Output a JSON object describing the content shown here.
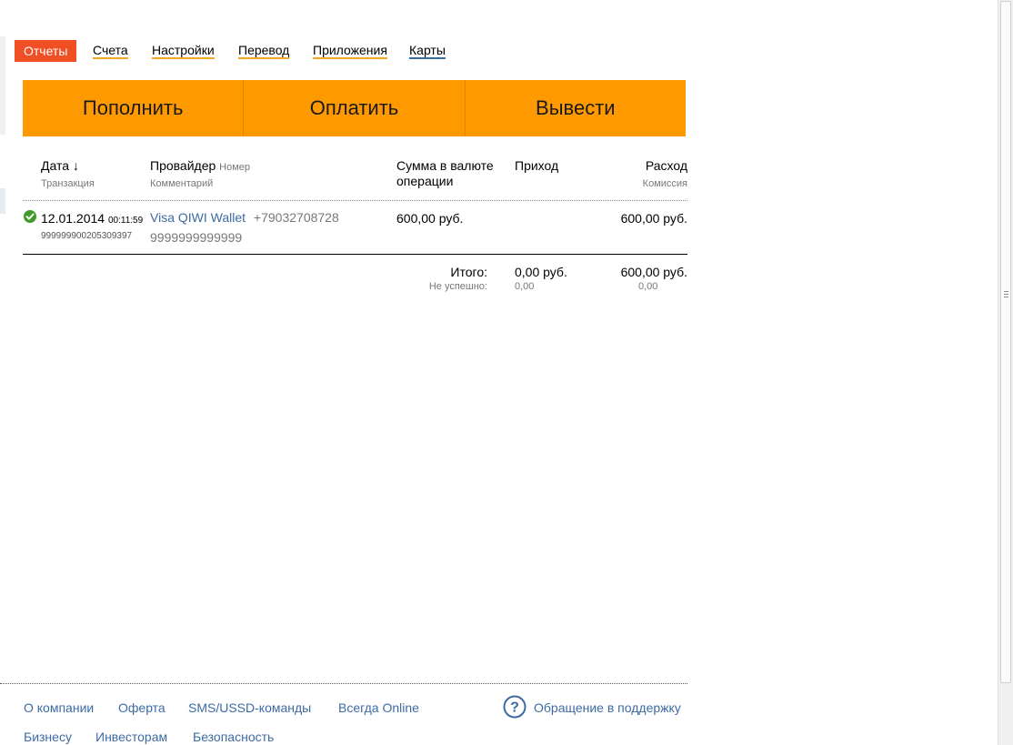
{
  "nav": {
    "tabs": [
      {
        "label": "Отчеты",
        "active": true
      },
      {
        "label": "Счета"
      },
      {
        "label": "Настройки"
      },
      {
        "label": "Перевод"
      },
      {
        "label": "Приложения"
      },
      {
        "label": "Карты"
      }
    ]
  },
  "actions": {
    "topup": "Пополнить",
    "pay": "Оплатить",
    "withdraw": "Вывести"
  },
  "table": {
    "headers": {
      "date": "Дата ↓",
      "transaction": "Транзакция",
      "provider": "Провайдер",
      "number": "Номер",
      "comment": "Комментарий",
      "amount_currency": "Сумма в валюте операции",
      "income": "Приход",
      "expense": "Расход",
      "commission": "Комиссия"
    },
    "rows": [
      {
        "status": "success",
        "date": "12.01.2014",
        "time": "00:11:59",
        "transaction_id": "999999900205309397",
        "provider": "Visa QIWI Wallet",
        "number": "+79032708728",
        "comment": "9999999999999",
        "amount": "600,00 руб.",
        "income": "",
        "expense": "600,00 руб."
      }
    ],
    "totals": {
      "label": "Итого:",
      "failed_label": "Не успешно:",
      "income": "0,00 руб.",
      "expense": "600,00 руб.",
      "failed_income": "0,00",
      "failed_expense": "0,00"
    }
  },
  "footer": {
    "links_row1": [
      "О компании",
      "Оферта",
      "SMS/USSD-команды",
      "Всегда Online"
    ],
    "support": "Обращение в поддержку",
    "links_row2": [
      "Бизнесу",
      "Инвесторам",
      "Безопасность"
    ]
  },
  "colors": {
    "accent_orange": "#ff9900",
    "active_tab": "#f04e23",
    "link_blue": "#3d6ba3",
    "success_green": "#3d9b2a"
  }
}
